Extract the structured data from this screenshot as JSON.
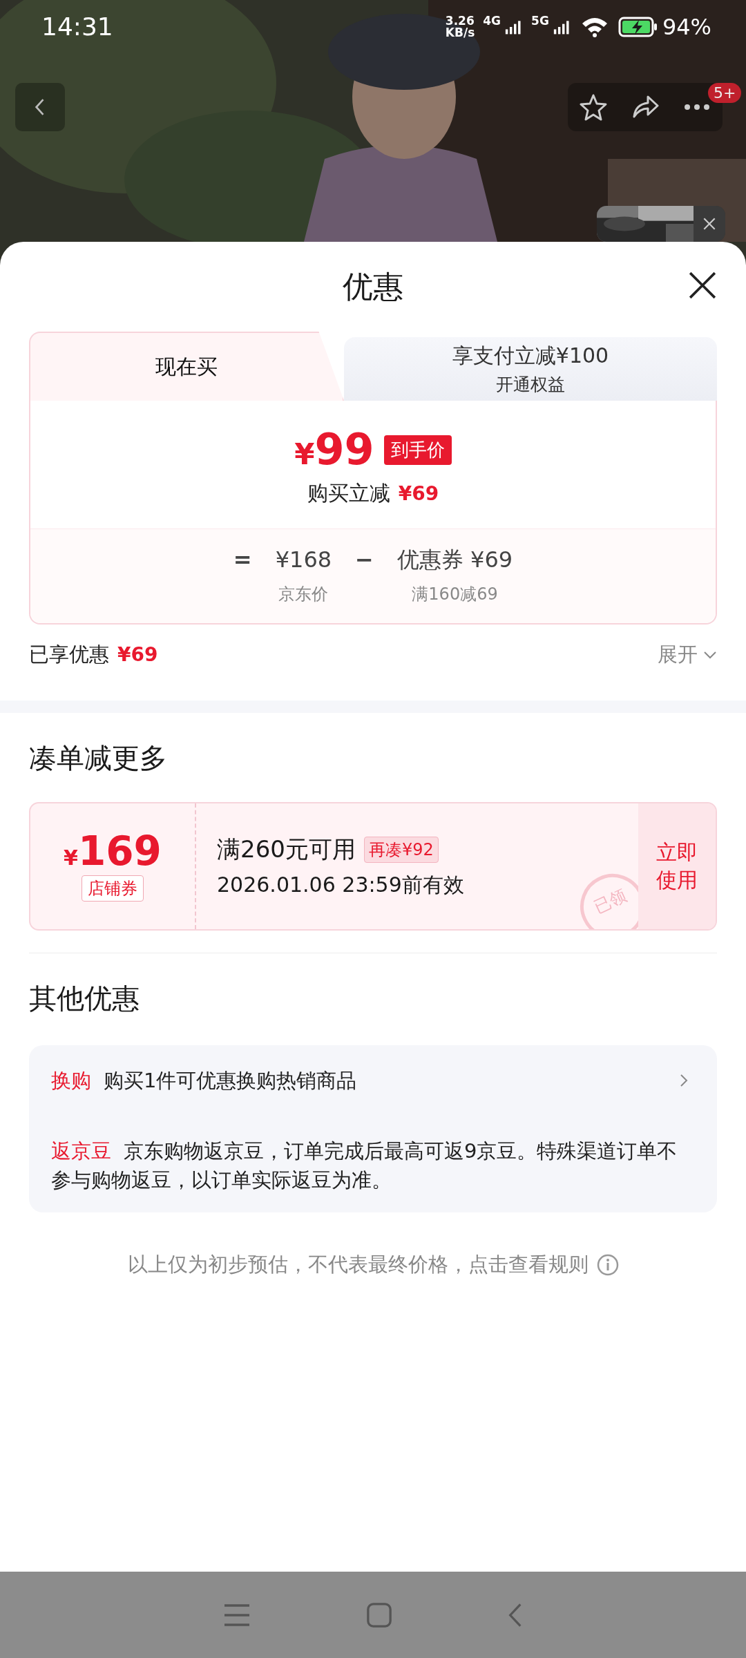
{
  "status_bar": {
    "time": "14:31",
    "speed_value": "3.26",
    "speed_unit": "KB/s",
    "networks": [
      "4G",
      "5G"
    ],
    "battery": "94%"
  },
  "top_bar": {
    "badge": "5+"
  },
  "sheet": {
    "title": "优惠",
    "tabs": [
      {
        "label": "现在买",
        "selected": true
      },
      {
        "label": "享支付立减¥100",
        "sublabel": "开通权益",
        "selected": false
      }
    ],
    "price": {
      "currency": "¥",
      "amount": "99",
      "tag": "到手价"
    },
    "saving": {
      "label": "购买立减",
      "amount": "¥69"
    },
    "formula": [
      {
        "kind": "operator",
        "symbol": "="
      },
      {
        "kind": "term",
        "value": "¥168",
        "caption": "京东价"
      },
      {
        "kind": "operator",
        "symbol": "−"
      },
      {
        "kind": "term",
        "value": "优惠券 ¥69",
        "caption": "满160减69"
      }
    ],
    "enjoyed": {
      "label": "已享优惠",
      "amount": "¥69",
      "expand": "展开"
    }
  },
  "bundle": {
    "title": "凑单减更多",
    "coupon": {
      "currency": "¥",
      "amount": "169",
      "type": "店铺券",
      "condition": "满260元可用",
      "extra": "再凑¥92",
      "validity": "2026.01.06 23:59前有效",
      "action": "立即使用",
      "stamp": "已领"
    }
  },
  "other": {
    "title": "其他优惠",
    "items": [
      {
        "tag": "换购",
        "text": "购买1件可优惠换购热销商品",
        "has_arrow": true
      },
      {
        "tag": "返京豆",
        "text": "京东购物返京豆，订单完成后最高可返9京豆。特殊渠道订单不参与购物返豆，以订单实际返豆为准。",
        "has_arrow": false
      }
    ],
    "footer": "以上仅为初步预估，不代表最终价格，点击查看规则"
  }
}
